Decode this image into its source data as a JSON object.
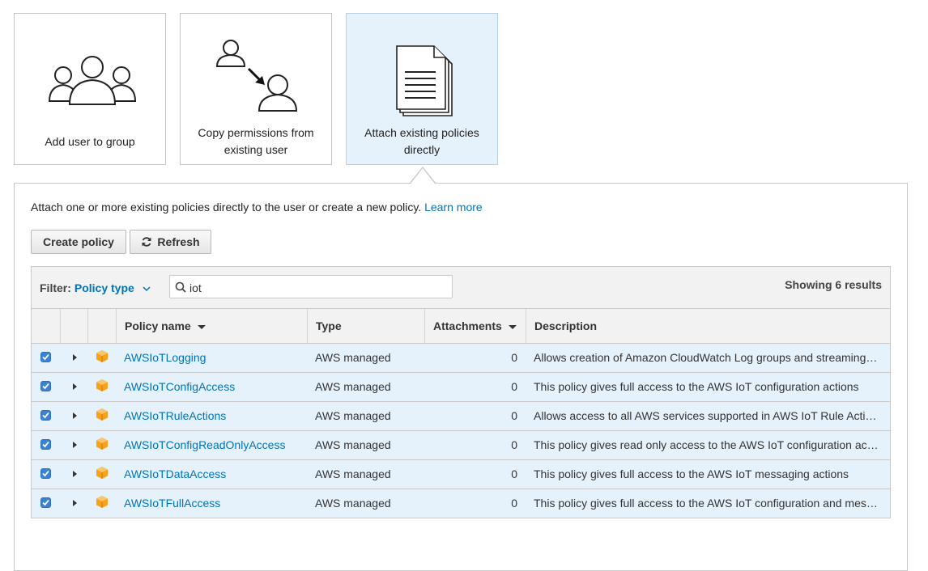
{
  "tiles": [
    {
      "label_line1": "Add user to group",
      "label_line2": ""
    },
    {
      "label_line1": "Copy permissions from",
      "label_line2": "existing user"
    },
    {
      "label_line1": "Attach existing policies",
      "label_line2": "directly"
    }
  ],
  "intro": {
    "text": "Attach one or more existing policies directly to the user or create a new policy.",
    "link": "Learn more"
  },
  "buttons": {
    "create_policy": "Create policy",
    "refresh": "Refresh"
  },
  "filter": {
    "label": "Filter:",
    "value": "Policy type",
    "search_value": "iot",
    "results_text": "Showing 6 results"
  },
  "columns": {
    "policy_name": "Policy name",
    "type": "Type",
    "attachments": "Attachments",
    "description": "Description"
  },
  "rows": [
    {
      "name": "AWSIoTLogging",
      "type": "AWS managed",
      "attachments": "0",
      "description": "Allows creation of Amazon CloudWatch Log groups and streaming…"
    },
    {
      "name": "AWSIoTConfigAccess",
      "type": "AWS managed",
      "attachments": "0",
      "description": "This policy gives full access to the AWS IoT configuration actions"
    },
    {
      "name": "AWSIoTRuleActions",
      "type": "AWS managed",
      "attachments": "0",
      "description": "Allows access to all AWS services supported in AWS IoT Rule Acti…"
    },
    {
      "name": "AWSIoTConfigReadOnlyAccess",
      "type": "AWS managed",
      "attachments": "0",
      "description": "This policy gives read only access to the AWS IoT configuration ac…"
    },
    {
      "name": "AWSIoTDataAccess",
      "type": "AWS managed",
      "attachments": "0",
      "description": "This policy gives full access to the AWS IoT messaging actions"
    },
    {
      "name": "AWSIoTFullAccess",
      "type": "AWS managed",
      "attachments": "0",
      "description": "This policy gives full access to the AWS IoT configuration and mes…"
    }
  ],
  "colors": {
    "link": "#0073bb",
    "selected_bg": "#e6f2fb",
    "policy_icon": "#f90"
  },
  "icons": {
    "group": "users-group-icon",
    "copy": "copy-permissions-icon",
    "document": "document-stack-icon",
    "search": "search-icon",
    "refresh": "refresh-icon",
    "policy": "policy-cube-icon"
  }
}
